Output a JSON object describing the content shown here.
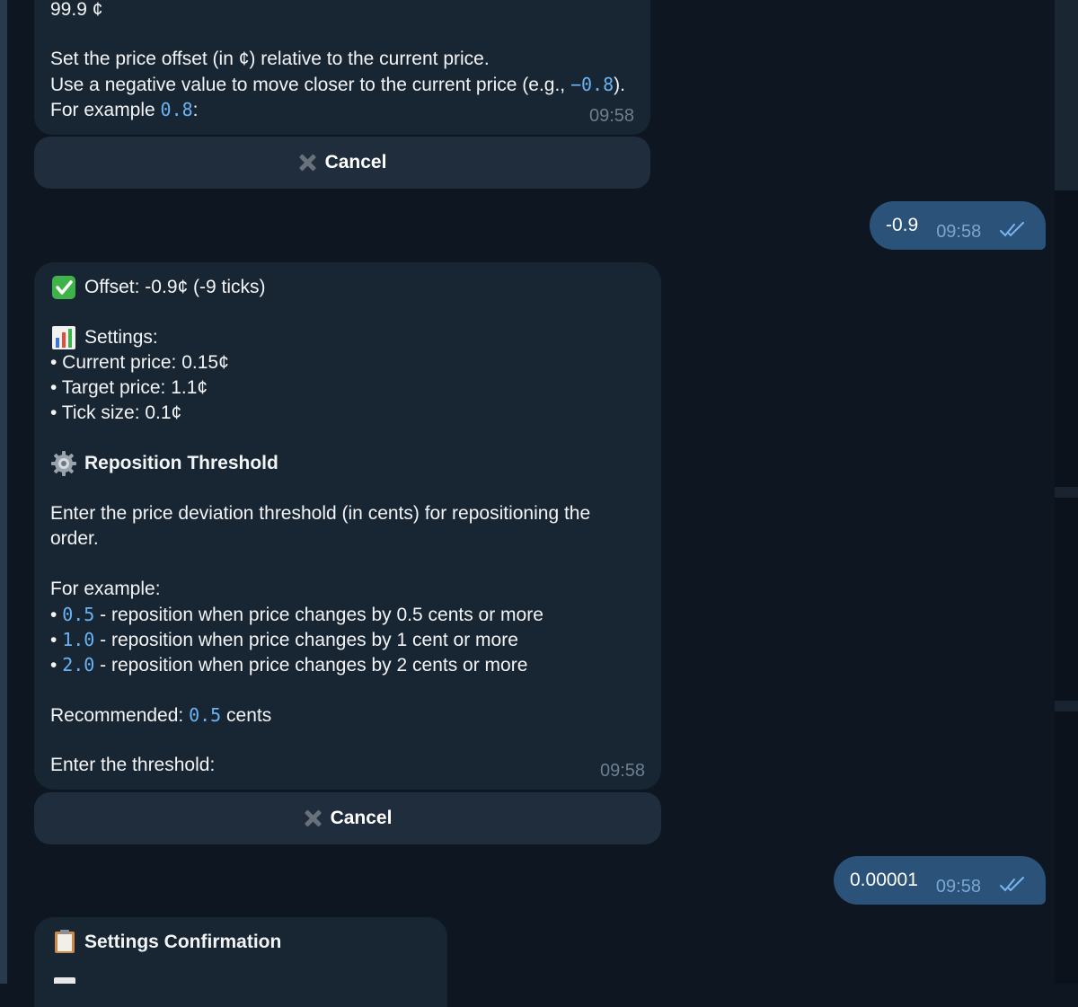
{
  "chat": {
    "msg1": {
      "top_line": "99.9 ¢",
      "line1": "Set the price offset (in ¢) relative to the current price.",
      "line2_prefix": "Use a negative value to move closer to the current price (e.g., ",
      "line2_code": "−0.8",
      "line2_suffix": ").",
      "line3_prefix": "For example ",
      "line3_code": "0.8",
      "line3_suffix": ":",
      "time": "09:58",
      "cancel_label": "Cancel"
    },
    "out1": {
      "text": "-0.9",
      "time": "09:58"
    },
    "msg2": {
      "offset_line": "Offset: -0.9¢ (-9 ticks)",
      "settings_heading": "Settings:",
      "settings_items": [
        "• Current price: 0.15¢",
        "• Target price: 1.1¢",
        "• Tick size: 0.1¢"
      ],
      "threshold_heading": "Reposition Threshold",
      "instructions_line1": "Enter the price deviation threshold (in cents) for repositioning the",
      "instructions_line2": "order.",
      "example_heading": "For example:",
      "examples": [
        {
          "code": "0.5",
          "text": " - reposition when price changes by 0.5 cents or more"
        },
        {
          "code": "1.0",
          "text": " - reposition when price changes by 1 cent or more"
        },
        {
          "code": "2.0",
          "text": " - reposition when price changes by 2 cents or more"
        }
      ],
      "recommended_prefix": "Recommended: ",
      "recommended_code": "0.5",
      "recommended_suffix": " cents",
      "prompt": "Enter the threshold:",
      "time": "09:58",
      "cancel_label": "Cancel"
    },
    "out2": {
      "text": "0.00001",
      "time": "09:58"
    },
    "msg3": {
      "heading": "Settings Confirmation"
    }
  },
  "icons": [
    "check-mark-emoji-icon",
    "bar-chart-emoji-icon",
    "gear-emoji-icon",
    "clipboard-emoji-icon",
    "close-icon",
    "double-check-icon"
  ],
  "colors": {
    "background": "#0e1621",
    "incoming_bubble": "#182533",
    "outgoing_bubble": "#2b5278",
    "code": "#6ab3f3"
  }
}
